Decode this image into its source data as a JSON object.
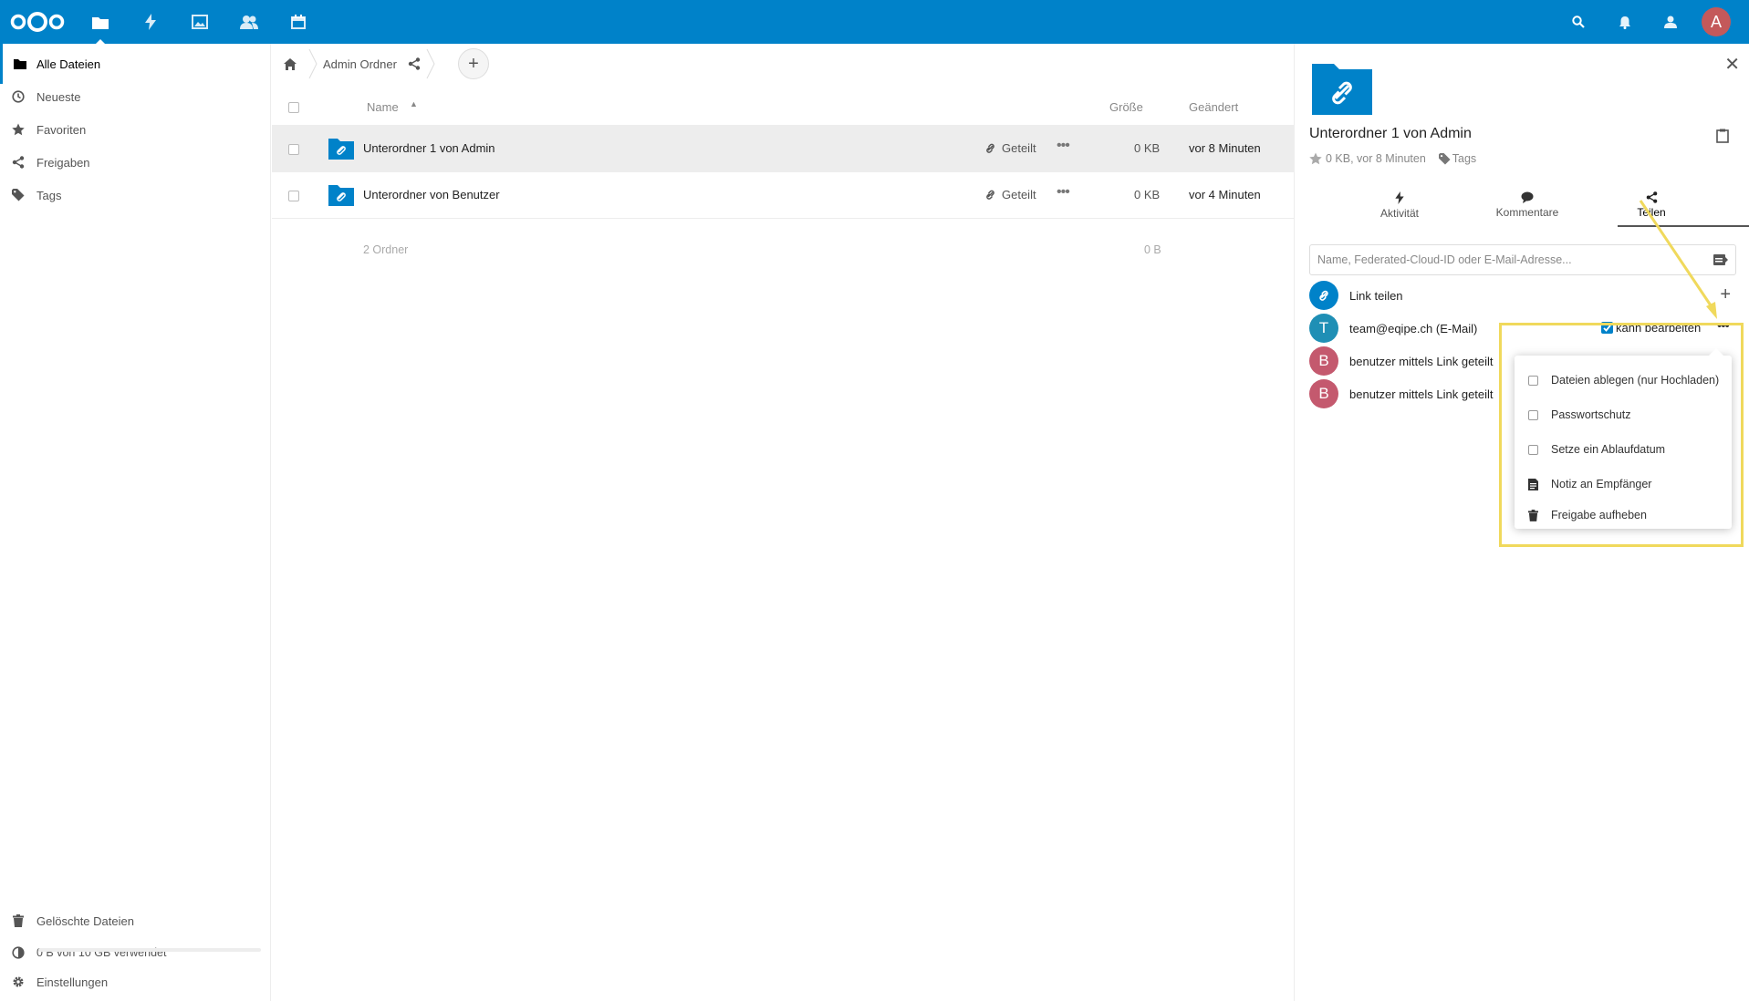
{
  "header": {
    "avatar_letter": "A",
    "apps": [
      "files-icon",
      "activity-icon",
      "photos-icon",
      "contacts-icon",
      "calendar-icon"
    ],
    "right_icons": [
      "search-icon",
      "notifications-icon",
      "contacts-menu-icon"
    ],
    "brand_color": "#0082c9"
  },
  "nav": {
    "items": [
      {
        "label": "Alle Dateien",
        "icon": "folder-icon"
      },
      {
        "label": "Neueste",
        "icon": "clock-icon"
      },
      {
        "label": "Favoriten",
        "icon": "star-icon"
      },
      {
        "label": "Freigaben",
        "icon": "share-icon"
      },
      {
        "label": "Tags",
        "icon": "tag-icon"
      }
    ],
    "deleted": "Gelöschte Dateien",
    "quota": "0 B von 10 GB verwendet",
    "settings": "Einstellungen"
  },
  "breadcrumb": {
    "folder": "Admin Ordner"
  },
  "table": {
    "col_name": "Name",
    "col_size": "Größe",
    "col_modified": "Geändert",
    "rows": [
      {
        "name": "Unterordner 1 von Admin",
        "shared": "Geteilt",
        "size": "0 KB",
        "modified": "vor 8 Minuten"
      },
      {
        "name": "Unterordner von Benutzer",
        "shared": "Geteilt",
        "size": "0 KB",
        "modified": "vor 4 Minuten"
      }
    ],
    "summary_count": "2 Ordner",
    "summary_size": "0 B"
  },
  "sidebar": {
    "title": "Unterordner 1 von Admin",
    "meta": "0 KB, vor 8 Minuten",
    "tags": "Tags",
    "tabs": [
      {
        "label": "Aktivität",
        "icon": "activity-icon"
      },
      {
        "label": "Kommentare",
        "icon": "comment-icon"
      },
      {
        "label": "Teilen",
        "icon": "share-icon"
      }
    ],
    "share_placeholder": "Name, Federated-Cloud-ID oder E-Mail-Adresse...",
    "link_share": "Link teilen",
    "shares": [
      {
        "avatar": "T",
        "label": "team@eqipe.ch (E-Mail)",
        "color": "#1f8fb5"
      },
      {
        "avatar": "B",
        "label": "benutzer mittels Link geteilt",
        "color": "#c4596e"
      },
      {
        "avatar": "B",
        "label": "benutzer mittels Link geteilt",
        "color": "#c4596e"
      }
    ],
    "can_edit": "kann bearbeiten",
    "menu": [
      {
        "label": "Dateien ablegen (nur Hochladen)",
        "icon": "checkbox"
      },
      {
        "label": "Passwortschutz",
        "icon": "checkbox"
      },
      {
        "label": "Setze ein Ablaufdatum",
        "icon": "checkbox"
      },
      {
        "label": "Notiz an Empfänger",
        "icon": "note-icon"
      },
      {
        "label": "Freigabe aufheben",
        "icon": "trash-icon"
      }
    ]
  }
}
